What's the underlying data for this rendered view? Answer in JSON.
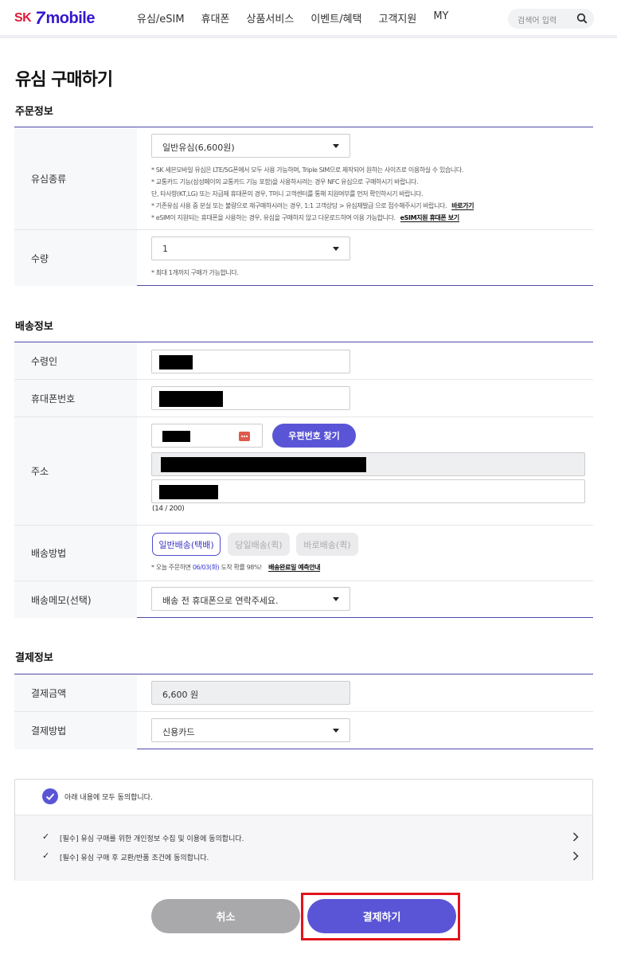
{
  "header": {
    "logo": {
      "sk": "SK",
      "brand": "mobile"
    },
    "nav": [
      "유심/eSIM",
      "휴대폰",
      "상품서비스",
      "이벤트/혜택",
      "고객지원",
      "MY"
    ],
    "search_placeholder": "검색어 입력"
  },
  "page_title": "유심 구매하기",
  "order": {
    "title": "주문정보",
    "usim_type_label": "유심종류",
    "usim_type_value": "일반유심(6,600원)",
    "notes": [
      "* SK 세븐모바일 유심은 LTE/5G폰에서 모두 사용 가능하며, Triple SIM으로 제작되어 원하는 사이즈로 이용하실 수 있습니다.",
      "* 교통카드 기능(삼성페이의 교통카드 기능 포함)을 사용하시려는 경우 NFC 유심으로 구매하시기 바랍니다.",
      "단, 타사향(KT,LG) 또는 자급제 휴대폰의 경우, T머니 고객센터를 통해 지원여부를 먼저 확인하시기 바랍니다.",
      "* 기존유심 사용 중 분실 또는 불량으로 재구매하시려는 경우, 1:1 고객상담 > 유심재발급 으로 접수해주시기 바랍니다.",
      "* eSIM이 지원되는 휴대폰을 사용하는 경우, 유심을 구매하지 않고 다운로드하여 이용 가능합니다."
    ],
    "link_go": "바로가기",
    "link_esim": "eSIM지원 휴대폰 보기",
    "qty_label": "수량",
    "qty_value": "1",
    "qty_note": "* 최대 1개까지 구매가 가능합니다."
  },
  "delivery": {
    "title": "배송정보",
    "receiver_label": "수령인",
    "phone_label": "휴대폰번호",
    "address_label": "주소",
    "zip_button": "우편번호 찾기",
    "char_count": "(14 / 200)",
    "method_label": "배송방법",
    "methods": [
      "일반배송(택배)",
      "당일배송(퀵)",
      "바로배송(퀵)"
    ],
    "eta_note_prefix": "* 오늘 주문하면",
    "eta_date": "06/03(화)",
    "eta_note_suffix": "도착 확률 98%!",
    "eta_link": "배송완료일 예측안내",
    "memo_label": "배송메모(선택)",
    "memo_value": "배송 전 휴대폰으로 연락주세요."
  },
  "payment": {
    "title": "결제정보",
    "amount_label": "결제금액",
    "amount_value": "6,600 원",
    "method_label": "결제방법",
    "method_value": "신용카드"
  },
  "agreement": {
    "all": "아래 내용에 모두 동의합니다.",
    "items": [
      "[필수] 유심 구매를 위한 개인정보 수집 및 이용에 동의합니다.",
      "[필수] 유심 구매 후 교환/반품 조건에 동의합니다."
    ]
  },
  "buttons": {
    "cancel": "취소",
    "pay": "결제하기"
  },
  "colors": {
    "brand": "#5a55d6",
    "highlight": "#e3131b",
    "logo_red": "#e31937",
    "logo_blue": "#3617ce"
  }
}
